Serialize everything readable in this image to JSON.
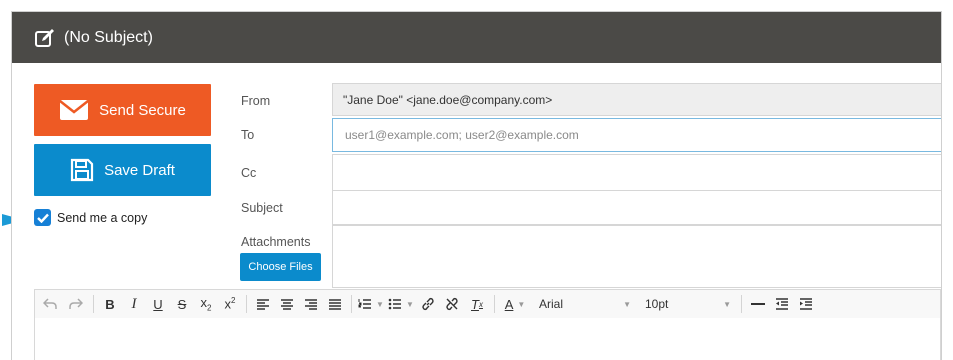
{
  "window": {
    "title": "(No Subject)"
  },
  "actions": {
    "send_label": "Send Secure",
    "draft_label": "Save Draft",
    "copy_label": "Send me a copy",
    "copy_checked": true
  },
  "fields": {
    "from_label": "From",
    "from_value": "\"Jane Doe\" <jane.doe@company.com>",
    "to_label": "To",
    "to_placeholder": "user1@example.com; user2@example.com",
    "cc_label": "Cc",
    "subject_label": "Subject",
    "attachments_label": "Attachments",
    "choose_files_label": "Choose Files"
  },
  "toolbar": {
    "font": "Arial",
    "size": "10pt"
  },
  "colors": {
    "send": "#ee5a24",
    "draft": "#0b8bcc",
    "header": "#4b4a47",
    "accent": "#1680d6"
  }
}
